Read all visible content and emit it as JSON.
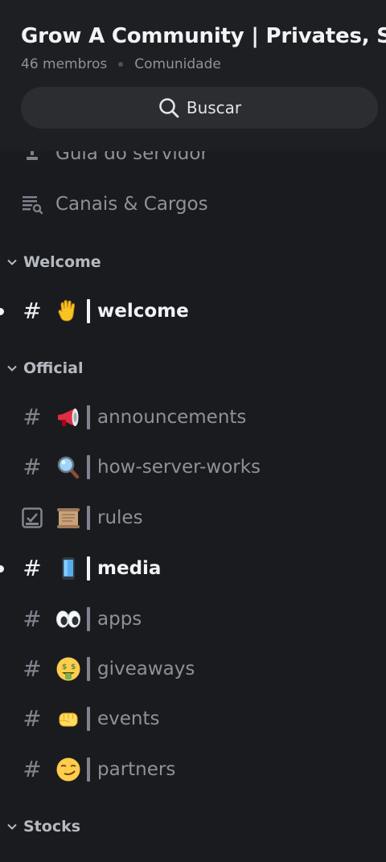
{
  "server": {
    "title": "Grow A Community | Privates, S…",
    "members": "46 membros",
    "type": "Comunidade"
  },
  "search": {
    "label": "Buscar",
    "icon": "search-icon"
  },
  "nav": [
    {
      "label": "Guia do servidor",
      "icon": "guide-icon"
    },
    {
      "label": "Canais & Cargos",
      "icon": "channels-roles-icon"
    }
  ],
  "categories": [
    {
      "label": "Welcome"
    },
    {
      "label": "Official"
    },
    {
      "label": "Stocks"
    }
  ],
  "channels": [
    {
      "name": "welcome",
      "emoji": "waving-hand",
      "unread": true
    },
    {
      "name": "announcements",
      "emoji": "megaphone",
      "unread": false
    },
    {
      "name": "how-server-works",
      "emoji": "magnifying-glass",
      "unread": false
    },
    {
      "name": "rules",
      "emoji": "scroll",
      "unread": false
    },
    {
      "name": "media",
      "emoji": "mobile-phone",
      "unread": true
    },
    {
      "name": "apps",
      "emoji": "eyes",
      "unread": false
    },
    {
      "name": "giveaways",
      "emoji": "money-mouth-face",
      "unread": false
    },
    {
      "name": "events",
      "emoji": "oncoming-fist",
      "unread": false
    },
    {
      "name": "partners",
      "emoji": "smirking-face",
      "unread": false
    }
  ],
  "colors": {
    "background": "#1a1b1f",
    "text_bright": "#f2f3f5",
    "text_muted": "#8e9297",
    "search_bg": "#2b2d31"
  }
}
